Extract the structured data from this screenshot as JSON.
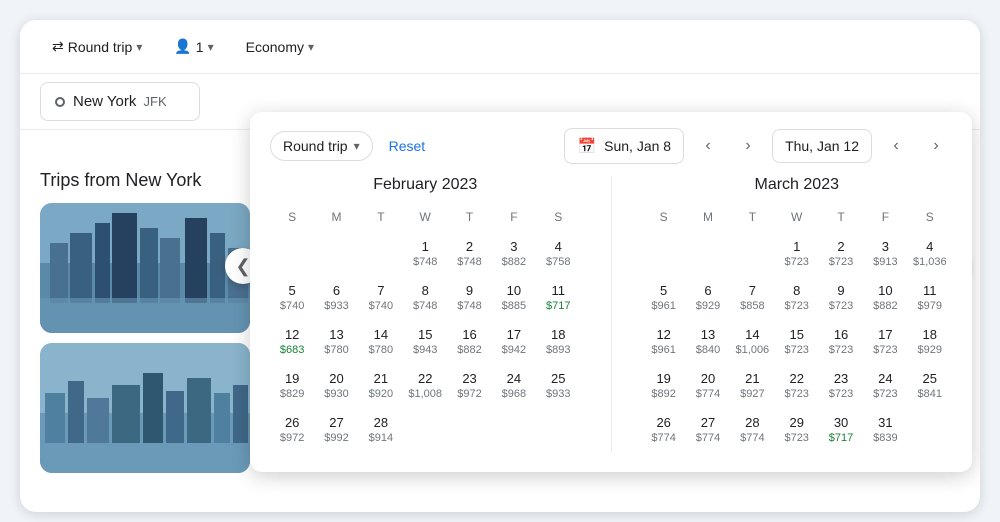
{
  "toolbar": {
    "round_trip_label": "Round trip",
    "passengers_label": "1",
    "cabin_label": "Economy"
  },
  "search": {
    "origin": "New York",
    "origin_code": "JFK"
  },
  "calendar_header": {
    "trip_type_label": "Round trip",
    "reset_label": "Reset",
    "start_date": "Sun, Jan 8",
    "end_date": "Thu, Jan 12"
  },
  "months": [
    {
      "title": "February 2023",
      "days_header": [
        "S",
        "M",
        "T",
        "W",
        "T",
        "F",
        "S"
      ],
      "weeks": [
        [
          {
            "day": "",
            "price": ""
          },
          {
            "day": "",
            "price": ""
          },
          {
            "day": "",
            "price": ""
          },
          {
            "day": "1",
            "price": "$748"
          },
          {
            "day": "2",
            "price": "$748"
          },
          {
            "day": "3",
            "price": "$882"
          },
          {
            "day": "4",
            "price": "$758"
          }
        ],
        [
          {
            "day": "5",
            "price": "$740"
          },
          {
            "day": "6",
            "price": "$933"
          },
          {
            "day": "7",
            "price": "$740"
          },
          {
            "day": "8",
            "price": "$748"
          },
          {
            "day": "9",
            "price": "$748"
          },
          {
            "day": "10",
            "price": "$885"
          },
          {
            "day": "11",
            "price": "$717",
            "cheap": true
          }
        ],
        [
          {
            "day": "12",
            "price": "$683",
            "cheap": true
          },
          {
            "day": "13",
            "price": "$780"
          },
          {
            "day": "14",
            "price": "$780"
          },
          {
            "day": "15",
            "price": "$943"
          },
          {
            "day": "16",
            "price": "$882"
          },
          {
            "day": "17",
            "price": "$942"
          },
          {
            "day": "18",
            "price": "$893"
          }
        ],
        [
          {
            "day": "19",
            "price": "$829"
          },
          {
            "day": "20",
            "price": "$930"
          },
          {
            "day": "21",
            "price": "$920"
          },
          {
            "day": "22",
            "price": "$1,008"
          },
          {
            "day": "23",
            "price": "$972"
          },
          {
            "day": "24",
            "price": "$968"
          },
          {
            "day": "25",
            "price": "$933"
          }
        ],
        [
          {
            "day": "26",
            "price": "$972"
          },
          {
            "day": "27",
            "price": "$992"
          },
          {
            "day": "28",
            "price": "$914"
          },
          {
            "day": "",
            "price": ""
          },
          {
            "day": "",
            "price": ""
          },
          {
            "day": "",
            "price": ""
          },
          {
            "day": "",
            "price": ""
          }
        ]
      ]
    },
    {
      "title": "March 2023",
      "days_header": [
        "S",
        "M",
        "T",
        "W",
        "T",
        "F",
        "S"
      ],
      "weeks": [
        [
          {
            "day": "",
            "price": ""
          },
          {
            "day": "",
            "price": ""
          },
          {
            "day": "",
            "price": ""
          },
          {
            "day": "1",
            "price": "$723"
          },
          {
            "day": "2",
            "price": "$723"
          },
          {
            "day": "3",
            "price": "$913"
          },
          {
            "day": "4",
            "price": "$1,036"
          }
        ],
        [
          {
            "day": "5",
            "price": "$961"
          },
          {
            "day": "6",
            "price": "$929"
          },
          {
            "day": "7",
            "price": "$858"
          },
          {
            "day": "8",
            "price": "$723"
          },
          {
            "day": "9",
            "price": "$723"
          },
          {
            "day": "10",
            "price": "$882"
          },
          {
            "day": "11",
            "price": "$979"
          }
        ],
        [
          {
            "day": "12",
            "price": "$961"
          },
          {
            "day": "13",
            "price": "$840"
          },
          {
            "day": "14",
            "price": "$1,006"
          },
          {
            "day": "15",
            "price": "$723"
          },
          {
            "day": "16",
            "price": "$723"
          },
          {
            "day": "17",
            "price": "$723"
          },
          {
            "day": "18",
            "price": "$929"
          }
        ],
        [
          {
            "day": "19",
            "price": "$892"
          },
          {
            "day": "20",
            "price": "$774"
          },
          {
            "day": "21",
            "price": "$927"
          },
          {
            "day": "22",
            "price": "$723"
          },
          {
            "day": "23",
            "price": "$723"
          },
          {
            "day": "24",
            "price": "$723"
          },
          {
            "day": "25",
            "price": "$841"
          }
        ],
        [
          {
            "day": "26",
            "price": "$774"
          },
          {
            "day": "27",
            "price": "$774"
          },
          {
            "day": "28",
            "price": "$774"
          },
          {
            "day": "29",
            "price": "$723"
          },
          {
            "day": "30",
            "price": "$717",
            "cheap": true
          },
          {
            "day": "31",
            "price": "$839"
          },
          {
            "day": "",
            "price": ""
          }
        ]
      ]
    }
  ],
  "sidebar": {
    "trips_title": "Trips from New York"
  },
  "icons": {
    "round_trip": "⇄",
    "passenger": "👤",
    "chevron_down": "▾",
    "calendar": "📅",
    "left_arrow": "‹",
    "right_arrow": "›",
    "left_nav": "❮",
    "right_nav": "❯"
  }
}
